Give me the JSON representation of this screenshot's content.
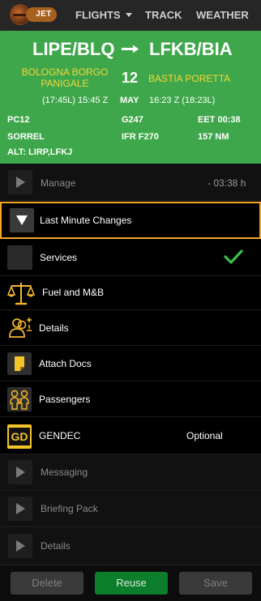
{
  "header": {
    "logo_text": "JET",
    "nav": [
      "FLIGHTS",
      "TRACK",
      "WEATHER"
    ]
  },
  "flight": {
    "departure_code": "LIPE/BLQ",
    "arrival_code": "LFKB/BIA",
    "departure_name": "BOLOGNA BORGO PANIGALE",
    "arrival_name": "BASTIA PORETTA",
    "day": "12",
    "month": "MAY",
    "departure_time": "(17:45L) 15:45 Z",
    "arrival_time": "16:23 Z (18:23L)",
    "aircraft_type": "PC12",
    "registration": "G247",
    "eet": "EET 00:38",
    "pic": "SORREL",
    "flight_rules": "IFR F270",
    "distance": "157 NM",
    "alternates": "ALT: LIRP,LFKJ"
  },
  "menu": {
    "manage_label": "Manage",
    "manage_time": "- 03:38 h",
    "lmc_label": "Last Minute Changes",
    "services_label": "Services",
    "fuel_label": "Fuel and M&B",
    "details_label": "Details",
    "attach_label": "Attach Docs",
    "passengers_label": "Passengers",
    "gendec_label": "GENDEC",
    "gendec_icon_text": "GD",
    "gendec_status": "Optional",
    "messaging_label": "Messaging",
    "briefing_label": "Briefing Pack",
    "details2_label": "Details"
  },
  "footer": {
    "delete": "Delete",
    "reuse": "Reuse",
    "save": "Save"
  },
  "colors": {
    "green_panel": "#3fa74b",
    "accent_yellow": "#f3d53a",
    "highlight_border": "#f5a623",
    "reuse_button": "#0c7d2b",
    "check_green": "#3bbf4a"
  }
}
